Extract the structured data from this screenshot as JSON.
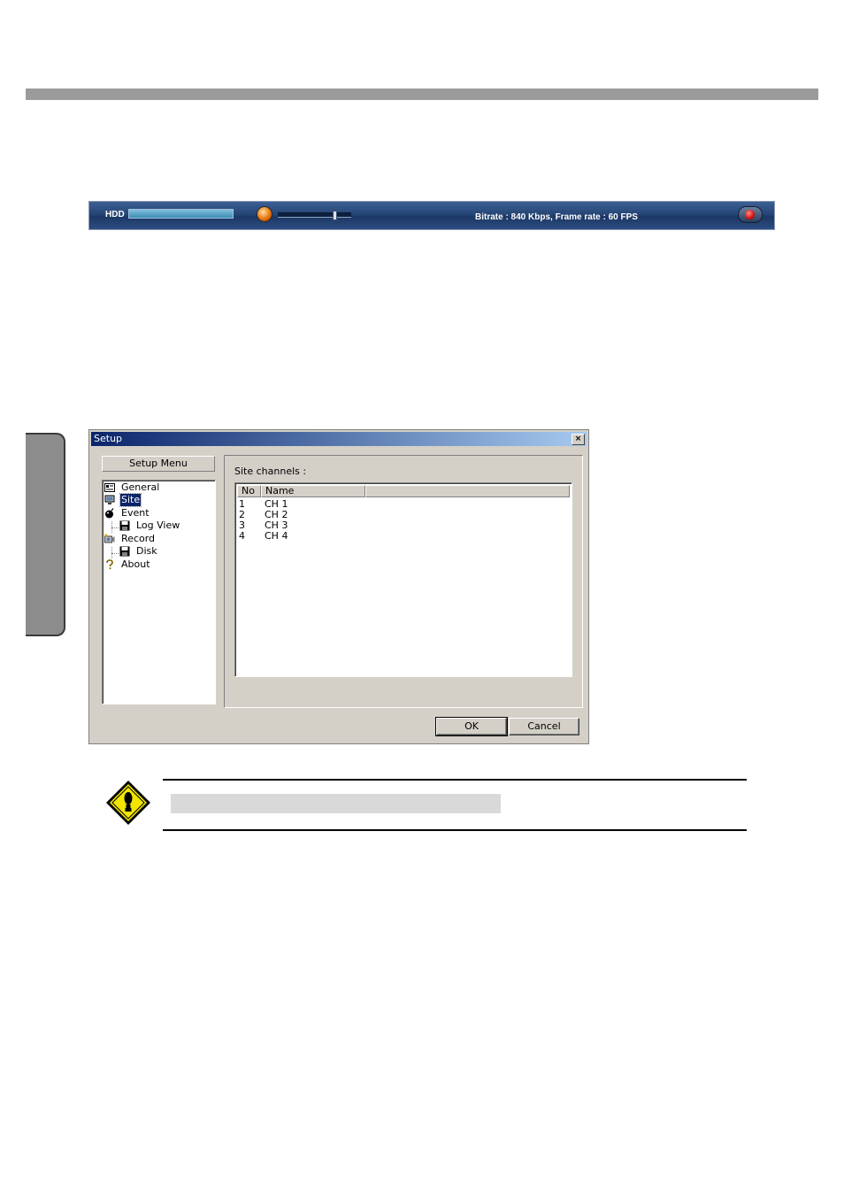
{
  "status_bar": {
    "hdd_label": "HDD",
    "hdd_level_percent": 100,
    "volume_level_percent": 80,
    "bitrate_text": "Bitrate : 840 Kbps, Frame rate : 60 FPS"
  },
  "dialog": {
    "title": "Setup",
    "close_glyph": "×",
    "menu_header": "Setup Menu",
    "tree": [
      {
        "label": "General",
        "icon": "general-icon",
        "indent": 0
      },
      {
        "label": "Site",
        "icon": "monitor-icon",
        "indent": 0,
        "selected": true
      },
      {
        "label": "Event",
        "icon": "bomb-icon",
        "indent": 0
      },
      {
        "label": "Log View",
        "icon": "floppy-disk-icon",
        "indent": 1
      },
      {
        "label": "Record",
        "icon": "record-icon",
        "indent": 0
      },
      {
        "label": "Disk",
        "icon": "floppy-disk-icon",
        "indent": 1
      },
      {
        "label": "About",
        "icon": "question-icon",
        "indent": 0
      }
    ],
    "group_label": "Site channels :",
    "columns": [
      "No",
      "Name"
    ],
    "rows": [
      {
        "no": "1",
        "name": "CH 1"
      },
      {
        "no": "2",
        "name": "CH 2"
      },
      {
        "no": "3",
        "name": "CH 3"
      },
      {
        "no": "4",
        "name": "CH 4"
      }
    ],
    "ok_label": "OK",
    "cancel_label": "Cancel"
  },
  "notice": {
    "icon": "caution-icon",
    "colors": {
      "icon_fill": "#f2e600",
      "icon_border": "#000000"
    }
  }
}
